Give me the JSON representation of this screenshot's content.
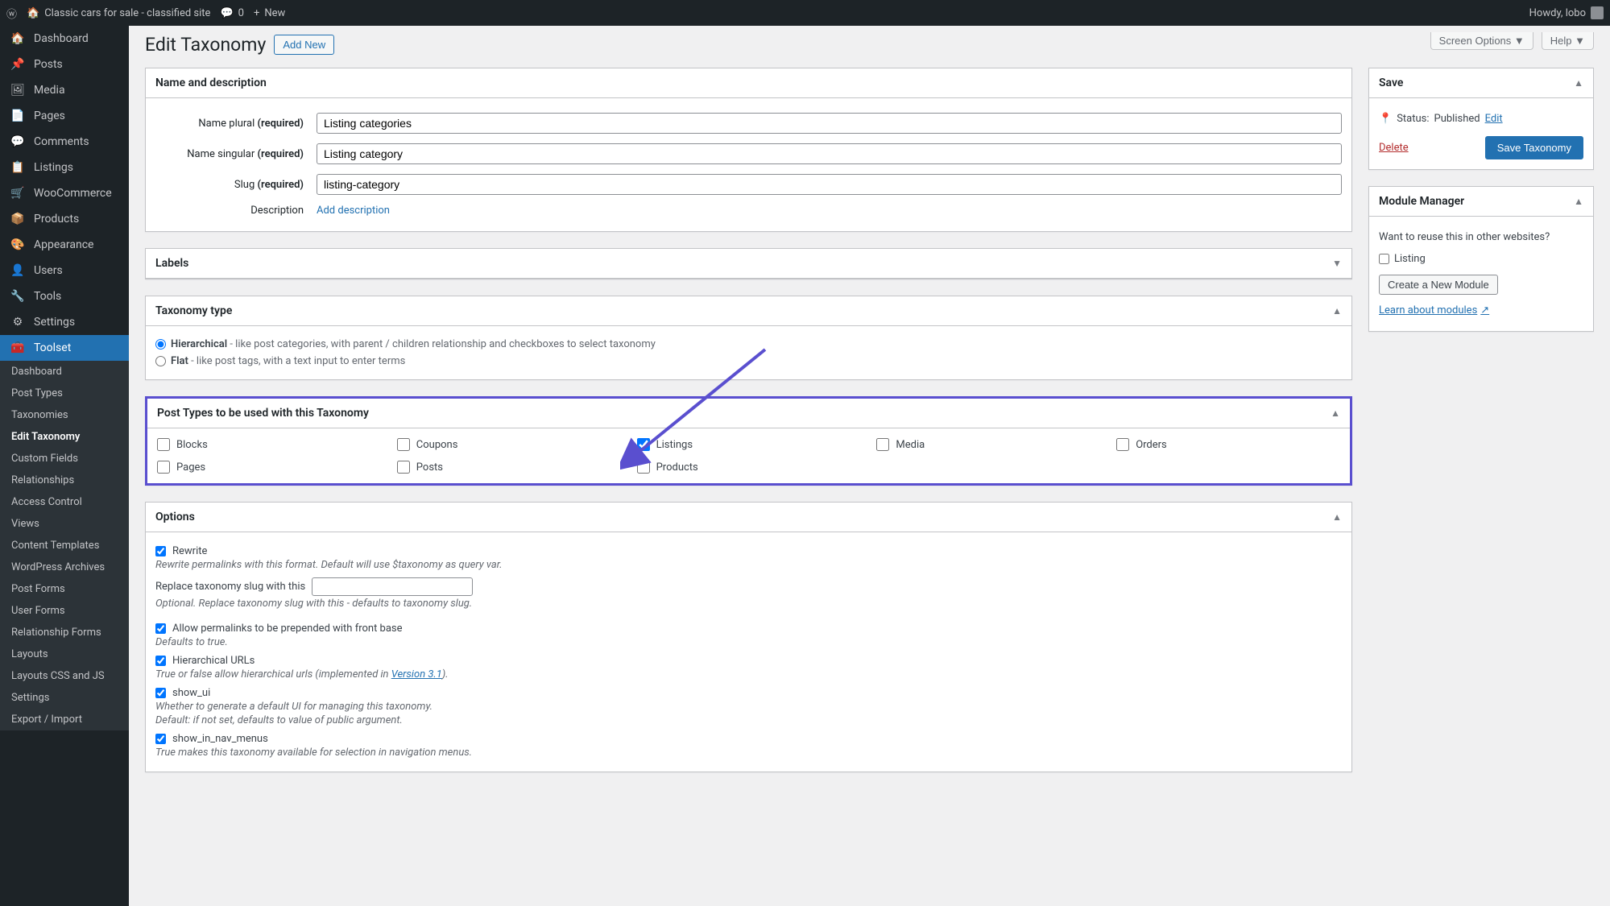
{
  "adminBar": {
    "siteName": "Classic cars for sale - classified site",
    "commentCount": "0",
    "new": "New",
    "greeting": "Howdy, lobo"
  },
  "sidebar": {
    "items": [
      {
        "label": "Dashboard",
        "icon": "🏠"
      },
      {
        "label": "Posts",
        "icon": "📌"
      },
      {
        "label": "Media",
        "icon": "🖼"
      },
      {
        "label": "Pages",
        "icon": "📄"
      },
      {
        "label": "Comments",
        "icon": "💬"
      },
      {
        "label": "Listings",
        "icon": "📋"
      },
      {
        "label": "WooCommerce",
        "icon": "🛒"
      },
      {
        "label": "Products",
        "icon": "📦"
      },
      {
        "label": "Appearance",
        "icon": "🎨"
      },
      {
        "label": "Users",
        "icon": "👤"
      },
      {
        "label": "Tools",
        "icon": "🔧"
      },
      {
        "label": "Settings",
        "icon": "⚙"
      },
      {
        "label": "Toolset",
        "icon": "🧰"
      }
    ],
    "submenu": [
      "Dashboard",
      "Post Types",
      "Taxonomies",
      "Edit Taxonomy",
      "Custom Fields",
      "Relationships",
      "Access Control",
      "Views",
      "Content Templates",
      "WordPress Archives",
      "Post Forms",
      "User Forms",
      "Relationship Forms",
      "Layouts",
      "Layouts CSS and JS",
      "Settings",
      "Export / Import"
    ]
  },
  "topButtons": {
    "screen": "Screen Options",
    "help": "Help"
  },
  "page": {
    "title": "Edit Taxonomy",
    "addNew": "Add New"
  },
  "nameBox": {
    "heading": "Name and description",
    "pluralLabel": "Name plural",
    "pluralReq": "(required)",
    "pluralValue": "Listing categories",
    "singularLabel": "Name singular",
    "singularReq": "(required)",
    "singularValue": "Listing category",
    "slugLabel": "Slug",
    "slugReq": "(required)",
    "slugValue": "listing-category",
    "descLabel": "Description",
    "descLink": "Add description"
  },
  "labelsBox": {
    "heading": "Labels"
  },
  "typeBox": {
    "heading": "Taxonomy type",
    "hierLabel": "Hierarchical",
    "hierDesc": " - like post categories, with parent / children relationship and checkboxes to select taxonomy",
    "flatLabel": "Flat",
    "flatDesc": " - like post tags, with a text input to enter terms"
  },
  "postTypesBox": {
    "heading": "Post Types to be used with this Taxonomy",
    "items": [
      "Blocks",
      "Coupons",
      "Listings",
      "Media",
      "Orders",
      "Pages",
      "Posts",
      "Products"
    ],
    "checked": [
      false,
      false,
      true,
      false,
      false,
      false,
      false,
      false
    ]
  },
  "optionsBox": {
    "heading": "Options",
    "rewrite": {
      "label": "Rewrite",
      "hint": "Rewrite permalinks with this format. Default will use $taxonomy as query var."
    },
    "replaceSlug": {
      "label": "Replace taxonomy slug with this",
      "hint": "Optional. Replace taxonomy slug with this - defaults to taxonomy slug."
    },
    "frontBase": {
      "label": "Allow permalinks to be prepended with front base",
      "hint": "Defaults to true."
    },
    "hierUrls": {
      "label": "Hierarchical URLs",
      "hint1": "True or false allow hierarchical urls (implemented in ",
      "link": "Version 3.1",
      "hint2": ")."
    },
    "showUi": {
      "label": "show_ui",
      "hint1": "Whether to generate a default UI for managing this taxonomy.",
      "hint2": "Default: if not set, defaults to value of public argument."
    },
    "showNav": {
      "label": "show_in_nav_menus",
      "hint": "True makes this taxonomy available for selection in navigation menus."
    }
  },
  "saveBox": {
    "heading": "Save",
    "statusLabel": "Status:",
    "statusValue": "Published",
    "editLink": "Edit",
    "deleteLink": "Delete",
    "saveBtn": "Save Taxonomy"
  },
  "moduleBox": {
    "heading": "Module Manager",
    "desc": "Want to reuse this in other websites?",
    "listing": "Listing",
    "createBtn": "Create a New Module",
    "learnLink": "Learn about modules"
  }
}
